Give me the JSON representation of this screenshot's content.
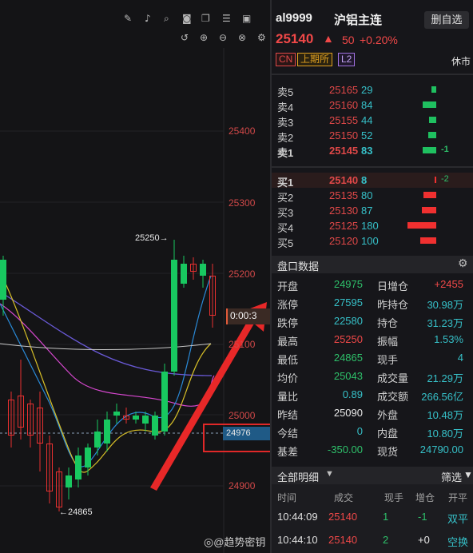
{
  "toolbar": {
    "icons": [
      "pencil-icon",
      "bell-icon",
      "search-icon",
      "camera-icon",
      "copy-icon",
      "list-icon",
      "layout-icon",
      "undo-icon",
      "zoom-in-icon",
      "zoom-out-icon",
      "close-icon",
      "settings-icon"
    ]
  },
  "chart": {
    "y_ticks": [
      "25400",
      "25300",
      "25200",
      "25100",
      "25000",
      "24900"
    ],
    "high_label": "25250→",
    "low_label": "←24865",
    "countdown": "0:00:3",
    "price_tag": "24976",
    "watermark": "@趋势密钥"
  },
  "chart_data": {
    "type": "candlestick",
    "y_ticks": [
      25400,
      25300,
      25200,
      25100,
      25000,
      24900
    ],
    "annotations": [
      {
        "label": "25250",
        "kind": "high"
      },
      {
        "label": "24865",
        "kind": "low"
      },
      {
        "label": "24976",
        "kind": "price-line"
      }
    ]
  },
  "header": {
    "symbol": "al9999",
    "name": "沪铝主连",
    "button": "删自选",
    "price": "25140",
    "arrow": "🠕",
    "change": "50",
    "change_pct": "+0.20%",
    "tags": [
      "CN",
      "上期所",
      "L2"
    ],
    "status": "休市"
  },
  "asks": [
    {
      "label": "卖5",
      "price": "25165",
      "vol": "29",
      "bar": 0.15,
      "delta": ""
    },
    {
      "label": "卖4",
      "price": "25160",
      "vol": "84",
      "bar": 0.42,
      "delta": ""
    },
    {
      "label": "卖3",
      "price": "25155",
      "vol": "44",
      "bar": 0.22,
      "delta": ""
    },
    {
      "label": "卖2",
      "price": "25150",
      "vol": "52",
      "bar": 0.26,
      "delta": ""
    },
    {
      "label": "卖1",
      "price": "25145",
      "vol": "83",
      "bar": 0.42,
      "delta": "-1"
    }
  ],
  "bids": [
    {
      "label": "买1",
      "price": "25140",
      "vol": "8",
      "bar": 0.04,
      "delta": "-2"
    },
    {
      "label": "买2",
      "price": "25135",
      "vol": "80",
      "bar": 0.4,
      "delta": ""
    },
    {
      "label": "买3",
      "price": "25130",
      "vol": "87",
      "bar": 0.44,
      "delta": ""
    },
    {
      "label": "买4",
      "price": "25125",
      "vol": "180",
      "bar": 0.9,
      "delta": ""
    },
    {
      "label": "买5",
      "price": "25120",
      "vol": "100",
      "bar": 0.5,
      "delta": ""
    }
  ],
  "pankou": {
    "title": "盘口数据",
    "left": [
      {
        "k": "开盘",
        "v": "24975",
        "c": "green"
      },
      {
        "k": "涨停",
        "v": "27595",
        "c": "cyan"
      },
      {
        "k": "跌停",
        "v": "22580",
        "c": "cyan"
      },
      {
        "k": "最高",
        "v": "25250",
        "c": "red"
      },
      {
        "k": "最低",
        "v": "24865",
        "c": "green"
      },
      {
        "k": "均价",
        "v": "25043",
        "c": "green"
      },
      {
        "k": "量比",
        "v": "0.89",
        "c": "cyan"
      },
      {
        "k": "昨结",
        "v": "25090",
        "c": "white"
      },
      {
        "k": "今结",
        "v": "0",
        "c": "cyan"
      },
      {
        "k": "基差",
        "v": "-350.00",
        "c": "green"
      }
    ],
    "right": [
      {
        "k": "日增仓",
        "v": "+2455",
        "c": "red"
      },
      {
        "k": "昨持仓",
        "v": "30.98万",
        "c": "cyan"
      },
      {
        "k": "持仓",
        "v": "31.23万",
        "c": "cyan"
      },
      {
        "k": "振幅",
        "v": "1.53%",
        "c": "cyan"
      },
      {
        "k": "现手",
        "v": "4",
        "c": "cyan"
      },
      {
        "k": "成交量",
        "v": "21.29万",
        "c": "cyan"
      },
      {
        "k": "成交额",
        "v": "266.56亿",
        "c": "cyan"
      },
      {
        "k": "外盘",
        "v": "10.48万",
        "c": "cyan"
      },
      {
        "k": "内盘",
        "v": "10.80万",
        "c": "cyan"
      },
      {
        "k": "现货",
        "v": "24790.00",
        "c": "cyan"
      }
    ]
  },
  "trades": {
    "filter": "全部明细",
    "filter_btn": "筛选",
    "headers": [
      "时间",
      "成交",
      "现手",
      "增仓",
      "开平"
    ],
    "rows": [
      {
        "time": "10:44:09",
        "price": "25140",
        "vol": "1",
        "oi": "-1",
        "type": "双平"
      },
      {
        "time": "10:44:10",
        "price": "25140",
        "vol": "2",
        "oi": "+0",
        "type": "空换"
      }
    ]
  }
}
